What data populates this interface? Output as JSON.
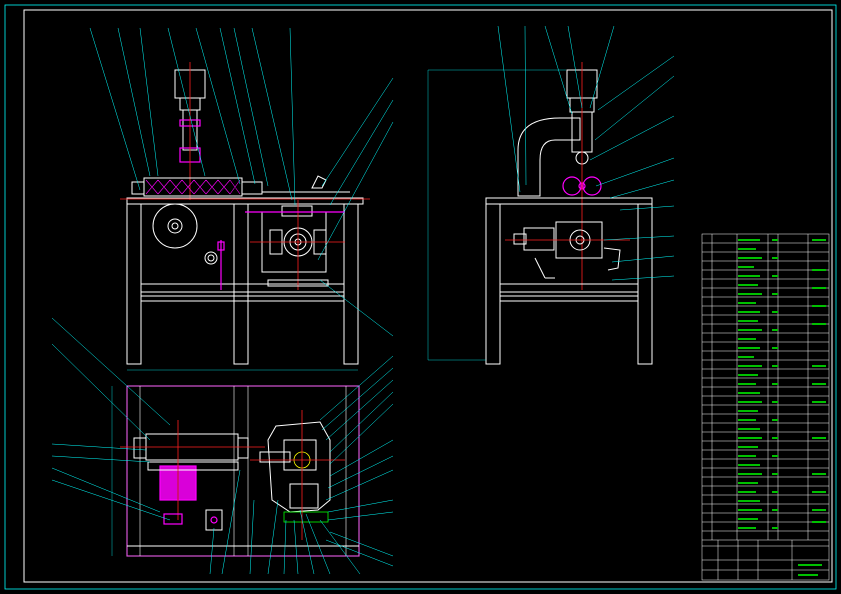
{
  "drawing": {
    "page_background": "#000000",
    "frame_color": "#00ffff",
    "outline_color": "#ffffff",
    "highlight_color": "#ff00ff",
    "centerline_color": "#ff2020",
    "text_color": "#ffff00"
  },
  "title_block": {
    "title_line": "",
    "subtitle_line": ""
  }
}
